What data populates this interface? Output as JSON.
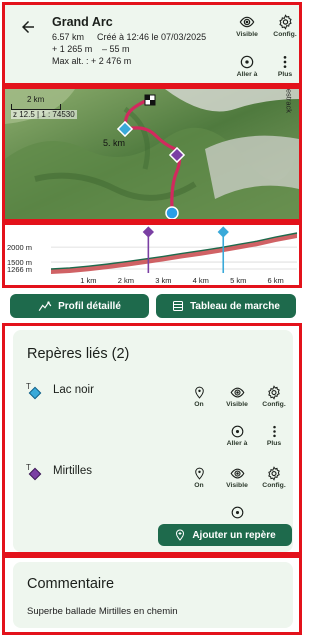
{
  "header": {
    "title": "Grand Arc",
    "distance": "6.57 km",
    "created": "Créé à 12:46 le 07/03/2025",
    "ascent": "+ 1 265 m",
    "descent": "– 55 m",
    "max_alt": "Max alt. : + 2 476 m",
    "actions": {
      "visible": "Visible",
      "config": "Config.",
      "goto": "Aller à",
      "more": "Plus"
    }
  },
  "map": {
    "scale_label": "2 km",
    "zoom_label": "z 12.5 | 1 : 74530",
    "km_marker": "5. km",
    "copyright": "© Tracestrack"
  },
  "chart_data": {
    "type": "area",
    "x": [
      0,
      0.5,
      1,
      1.5,
      2,
      2.5,
      3,
      3.5,
      4,
      4.5,
      5,
      5.5,
      6,
      6.57
    ],
    "y": [
      1266,
      1300,
      1360,
      1430,
      1510,
      1600,
      1690,
      1790,
      1880,
      1980,
      2090,
      2200,
      2340,
      2476
    ],
    "xlim": [
      0,
      6.57
    ],
    "ylim": [
      1266,
      2476
    ],
    "y_ticks": [
      "2000 m",
      "1500 m",
      "1266 m"
    ],
    "x_ticks": [
      "1 km",
      "2 km",
      "3 km",
      "4 km",
      "5 km",
      "6 km"
    ],
    "marker_positions_km": [
      2.6,
      4.6
    ],
    "colors": {
      "line": "#1e6a4c",
      "slope": "#c8464a",
      "marker1": "#7a3fa3",
      "marker2": "#39a9d9"
    }
  },
  "buttons": {
    "profile": "Profil détaillé",
    "table": "Tableau de marche"
  },
  "linked": {
    "title": "Repères liés (2)",
    "tsign": "T",
    "markers": [
      {
        "name": "Lac noir",
        "on": "On",
        "visible": "Visible",
        "config": "Config.",
        "goto": "Aller à",
        "more": "Plus"
      },
      {
        "name": "Mirtilles",
        "on": "On",
        "visible": "Visible",
        "config": "Config."
      }
    ],
    "add_label": "Ajouter un repère"
  },
  "comment": {
    "title": "Commentaire",
    "text": "Superbe ballade Mirtilles en chemin"
  },
  "colors": {
    "accent": "#1e6a4c",
    "panel": "#eef6ee",
    "highlight": "#e3121b",
    "track": "#d12a5e"
  }
}
